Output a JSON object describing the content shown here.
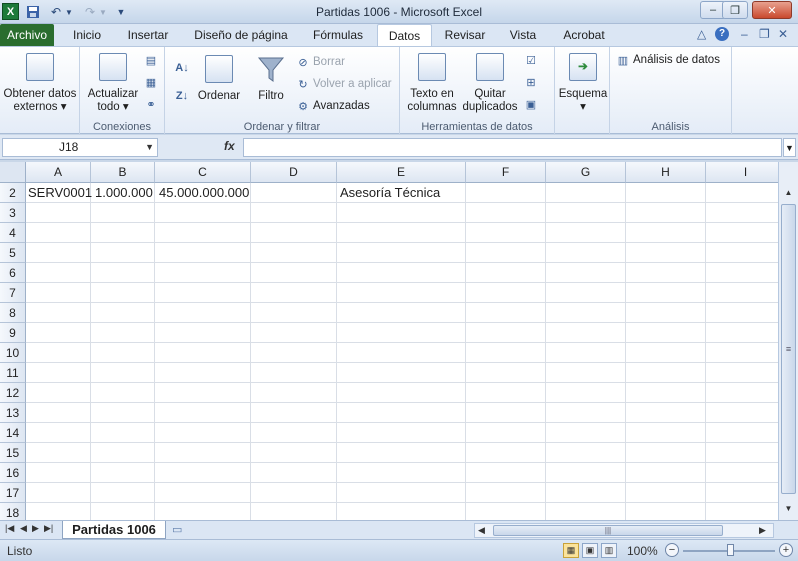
{
  "window": {
    "title": "Partidas 1006 - Microsoft Excel"
  },
  "tabs": [
    {
      "label": "Archivo"
    },
    {
      "label": "Inicio"
    },
    {
      "label": "Insertar"
    },
    {
      "label": "Diseño de página"
    },
    {
      "label": "Fórmulas"
    },
    {
      "label": "Datos"
    },
    {
      "label": "Revisar"
    },
    {
      "label": "Vista"
    },
    {
      "label": "Acrobat"
    }
  ],
  "ribbon": {
    "external_data": {
      "label": "Obtener datos externos"
    },
    "connections": {
      "refresh_label": "Actualizar todo",
      "group_label": "Conexiones"
    },
    "sort_filter": {
      "sort_label": "Ordenar",
      "filter_label": "Filtro",
      "clear_label": "Borrar",
      "reapply_label": "Volver a aplicar",
      "advanced_label": "Avanzadas",
      "group_label": "Ordenar y filtrar"
    },
    "data_tools": {
      "text_to_columns_label": "Texto en columnas",
      "remove_duplicates_label": "Quitar duplicados",
      "group_label": "Herramientas de datos"
    },
    "outline": {
      "label": "Esquema"
    },
    "analysis": {
      "label": "Análisis de datos",
      "group_label": "Análisis"
    }
  },
  "formula_bar": {
    "name_box": "J18",
    "fx": "fx",
    "formula": ""
  },
  "columns": [
    "A",
    "B",
    "C",
    "D",
    "E",
    "F",
    "G",
    "H",
    "I"
  ],
  "rows": [
    "2",
    "3",
    "4",
    "5",
    "6",
    "7",
    "8",
    "9",
    "10",
    "11",
    "12",
    "13",
    "14",
    "15",
    "16",
    "17",
    "18"
  ],
  "cells": {
    "A2": "SERV0001",
    "B2": "1.000.000",
    "C2": "45.000.000.000",
    "E2": "Asesoría Técnica"
  },
  "sheet_tab": "Partidas 1006",
  "status": {
    "ready": "Listo",
    "zoom": "100%"
  }
}
